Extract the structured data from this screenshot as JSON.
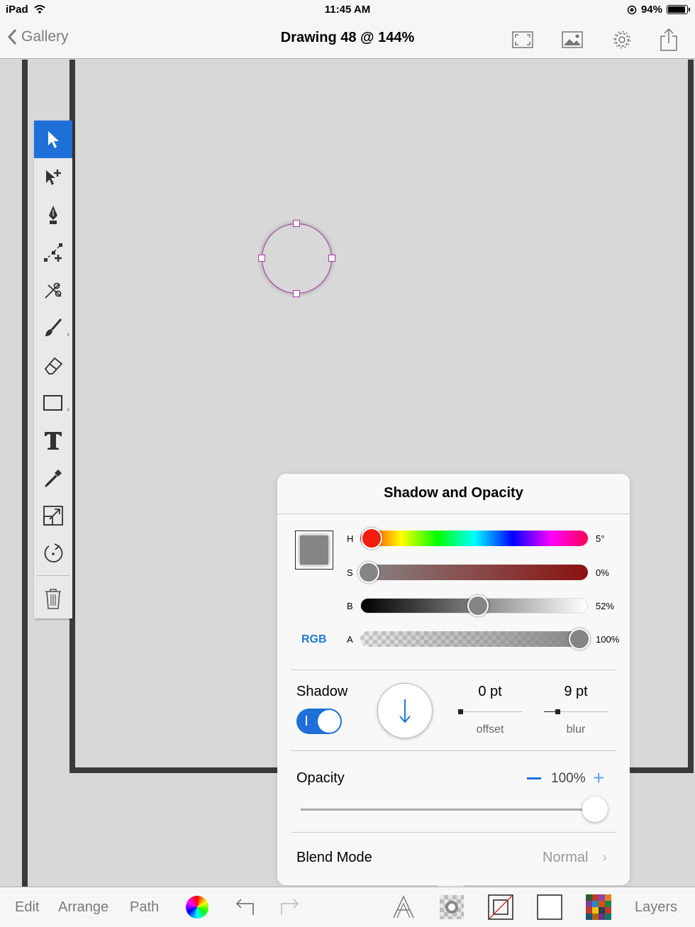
{
  "status_bar": {
    "device": "iPad",
    "time": "11:45 AM",
    "battery": "94%"
  },
  "nav": {
    "back_label": "Gallery",
    "title": "Drawing 48 @ 144%"
  },
  "popover": {
    "title": "Shadow and Opacity",
    "hsba": {
      "h_label": "H",
      "h_value": "5°",
      "s_label": "S",
      "s_value": "0%",
      "b_label": "B",
      "b_value": "52%",
      "a_label": "A",
      "a_value": "100%",
      "mode_label": "RGB",
      "h_fraction": 0.014,
      "s_fraction": 0.0,
      "b_fraction": 0.52,
      "a_fraction": 1.0,
      "swatch_color": "#858585"
    },
    "shadow": {
      "label": "Shadow",
      "enabled": true,
      "offset_value": "0 pt",
      "offset_caption": "offset",
      "blur_value": "9 pt",
      "blur_caption": "blur"
    },
    "opacity": {
      "label": "Opacity",
      "value": "100%",
      "fraction": 1.0
    },
    "blend": {
      "label": "Blend Mode",
      "value": "Normal"
    }
  },
  "bottom_bar": {
    "edit": "Edit",
    "arrange": "Arrange",
    "path": "Path",
    "layers": "Layers"
  },
  "colors": {
    "accent": "#1f6fd8",
    "selection": "#a23ba0",
    "frame": "#3a3a3a"
  }
}
